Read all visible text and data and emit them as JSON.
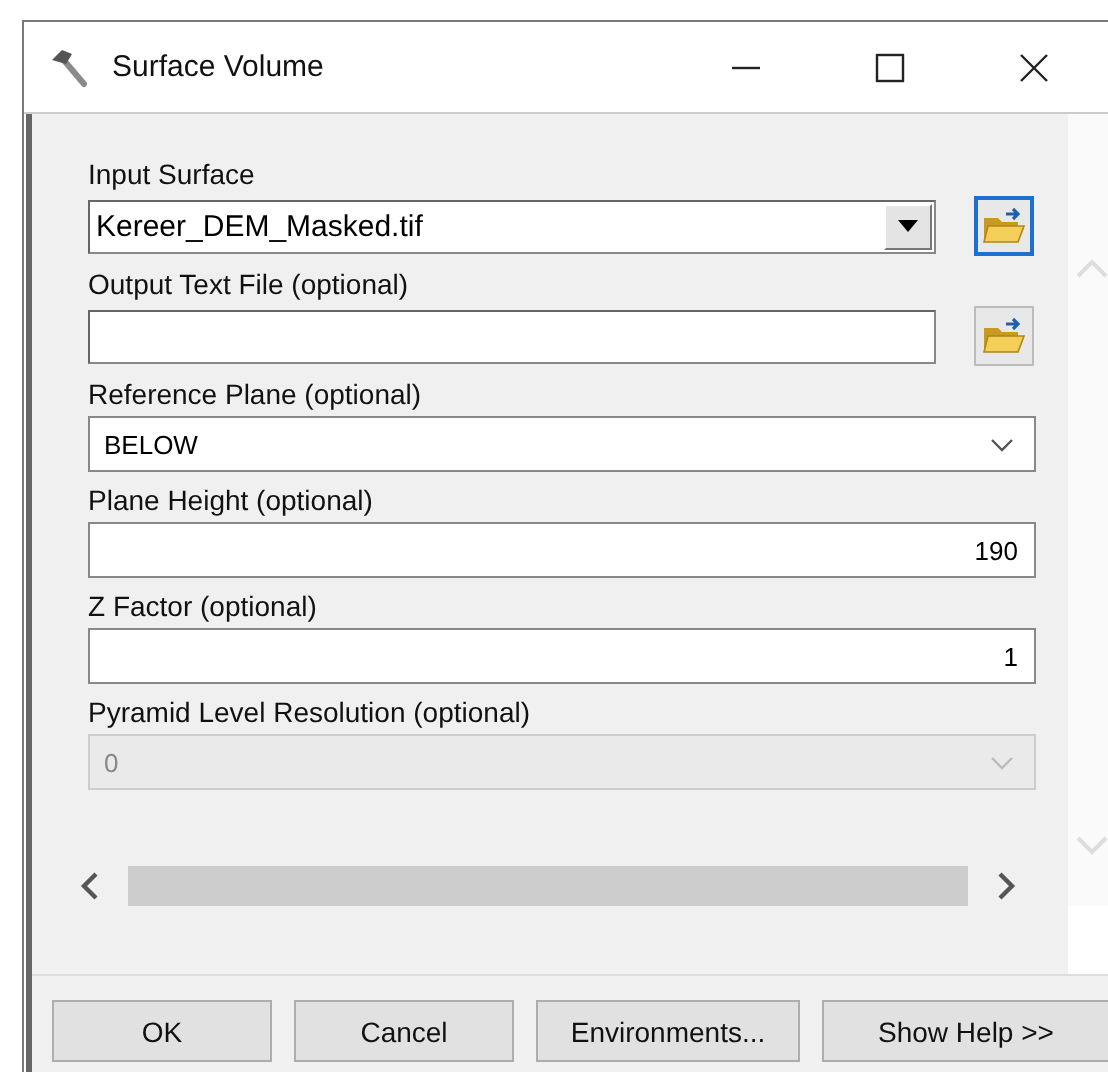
{
  "window": {
    "title": "Surface Volume"
  },
  "fields": [
    {
      "kind": "combo",
      "label": "Input Surface",
      "value": "Kereer_DEM_Masked.tif",
      "disabled": false,
      "browse": {
        "focused": true
      }
    },
    {
      "kind": "text",
      "label": "Output Text File (optional)",
      "disabled": false,
      "browse": {
        "focused": false
      }
    },
    {
      "kind": "dropdown",
      "label": "Reference Plane (optional)",
      "value": "BELOW",
      "disabled": false
    },
    {
      "kind": "number",
      "label": "Plane Height (optional)",
      "value": "190",
      "disabled": false
    },
    {
      "kind": "number",
      "label": "Z Factor (optional)",
      "value": "1",
      "disabled": false
    },
    {
      "kind": "dropdown",
      "label": "Pyramid Level Resolution (optional)",
      "value": "0",
      "disabled": true
    }
  ],
  "buttons": [
    "OK",
    "Cancel",
    "Environments...",
    "Show Help >>"
  ]
}
